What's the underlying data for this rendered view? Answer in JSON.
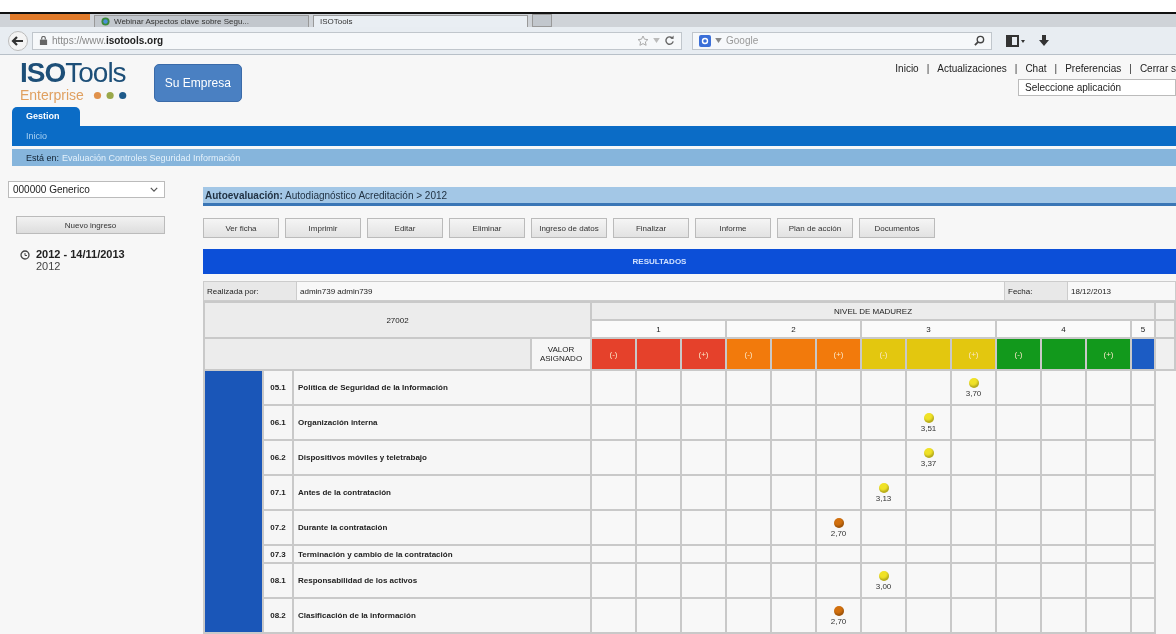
{
  "browser": {
    "tabs": [
      {
        "title": "Webinar Aspectos clave sobre Segu...",
        "selected": false
      },
      {
        "title": "ISOTools",
        "selected": true
      }
    ],
    "url_prefix": "https://www.",
    "url_domain": "isotools.org",
    "search": {
      "placeholder": "Google"
    }
  },
  "header": {
    "logo": {
      "bold": "ISO",
      "rest": "Tools",
      "edition": "Enterprise"
    },
    "company_button": "Su Empresa",
    "links": [
      {
        "label": "Inicio"
      },
      {
        "label": "Actualizaciones"
      },
      {
        "label": "Chat"
      },
      {
        "label": "Preferencias"
      },
      {
        "label": "Cerrar s"
      }
    ],
    "separators": [
      "|",
      "|",
      "|",
      "|"
    ],
    "app_select": {
      "value": "Seleccione aplicación"
    }
  },
  "nav": {
    "tabs": [
      {
        "label": "Gestion",
        "selected": true
      }
    ],
    "subnav": [
      {
        "label": "Inicio"
      }
    ]
  },
  "breadcrumb": {
    "label": "Está en:",
    "path": "Evaluación Controles Seguridad Información"
  },
  "sidebar": {
    "org_select": {
      "value": "000000 Generico"
    },
    "new_button": "Nuevo ingreso",
    "periods": [
      {
        "title": "2012 - 14/11/2013",
        "subtitle": "2012"
      }
    ]
  },
  "evaluation": {
    "label": "Autoevaluación:",
    "title": "Autodiagnóstico Acreditación > 2012"
  },
  "toolbar": [
    "Ver ficha",
    "Imprimir",
    "Editar",
    "Eliminar",
    "Ingreso de datos",
    "Finalizar",
    "Informe",
    "Plan de acción",
    "Documentos"
  ],
  "results": {
    "title": "RESULTADOS",
    "performed_by_label": "Realizada por:",
    "performed_by": "admin739 admin739",
    "date_label": "Fecha:",
    "date": "18/12/2013",
    "standard": "27002",
    "maturity_title": "NIVEL DE MADUREZ",
    "value_header": "VALOR ASIGNADO",
    "levels": [
      {
        "label": "1",
        "color": "#e5412b",
        "bands": [
          {
            "kind": "minus",
            "text": "(-)"
          },
          {
            "kind": "mid"
          },
          {
            "kind": "plus",
            "text": "(+)"
          }
        ]
      },
      {
        "label": "2",
        "color": "#f27a0c",
        "bands": [
          {
            "kind": "minus",
            "text": "(-)"
          },
          {
            "kind": "mid"
          },
          {
            "kind": "plus",
            "text": "(+)"
          }
        ]
      },
      {
        "label": "3",
        "color": "#e3c70f",
        "bands": [
          {
            "kind": "minus",
            "text": "(-)"
          },
          {
            "kind": "mid"
          },
          {
            "kind": "plus",
            "text": "(+)"
          }
        ]
      },
      {
        "label": "4",
        "color": "#12991c",
        "bands": [
          {
            "kind": "minus",
            "text": "(-)"
          },
          {
            "kind": "mid"
          },
          {
            "kind": "plus",
            "text": "(+)"
          }
        ]
      },
      {
        "label": "5",
        "color": "#1c5cc4",
        "bands": [
          {
            "kind": "mid"
          }
        ]
      }
    ],
    "rows": [
      {
        "code": "05.1",
        "name": "Política de Seguridad de la Información",
        "cells": [
          {
            "marked": false
          },
          {
            "marked": false
          },
          {
            "marked": false
          },
          {
            "marked": false
          },
          {
            "marked": false
          },
          {
            "marked": false
          },
          {
            "marked": false
          },
          {
            "marked": false
          },
          {
            "marked": true,
            "value": "3,70",
            "color": "#f0e226"
          },
          {
            "marked": false
          },
          {
            "marked": false
          },
          {
            "marked": false
          },
          {
            "marked": false
          }
        ]
      },
      {
        "code": "06.1",
        "name": "Organización interna",
        "cells": [
          {
            "marked": false
          },
          {
            "marked": false
          },
          {
            "marked": false
          },
          {
            "marked": false
          },
          {
            "marked": false
          },
          {
            "marked": false
          },
          {
            "marked": false
          },
          {
            "marked": true,
            "value": "3,51",
            "color": "#f0e226"
          },
          {
            "marked": false
          },
          {
            "marked": false
          },
          {
            "marked": false
          },
          {
            "marked": false
          },
          {
            "marked": false
          }
        ]
      },
      {
        "code": "06.2",
        "name": "Dispositivos móviles y teletrabajo",
        "cells": [
          {
            "marked": false
          },
          {
            "marked": false
          },
          {
            "marked": false
          },
          {
            "marked": false
          },
          {
            "marked": false
          },
          {
            "marked": false
          },
          {
            "marked": false
          },
          {
            "marked": true,
            "value": "3,37",
            "color": "#f0e226"
          },
          {
            "marked": false
          },
          {
            "marked": false
          },
          {
            "marked": false
          },
          {
            "marked": false
          },
          {
            "marked": false
          }
        ]
      },
      {
        "code": "07.1",
        "name": "Antes de la contratación",
        "cells": [
          {
            "marked": false
          },
          {
            "marked": false
          },
          {
            "marked": false
          },
          {
            "marked": false
          },
          {
            "marked": false
          },
          {
            "marked": false
          },
          {
            "marked": true,
            "value": "3,13",
            "color": "#f0e226"
          },
          {
            "marked": false
          },
          {
            "marked": false
          },
          {
            "marked": false
          },
          {
            "marked": false
          },
          {
            "marked": false
          },
          {
            "marked": false
          }
        ]
      },
      {
        "code": "07.2",
        "name": "Durante la contratación",
        "cells": [
          {
            "marked": false
          },
          {
            "marked": false
          },
          {
            "marked": false
          },
          {
            "marked": false
          },
          {
            "marked": false
          },
          {
            "marked": true,
            "value": "2,70",
            "color": "#d2700e"
          },
          {
            "marked": false
          },
          {
            "marked": false
          },
          {
            "marked": false
          },
          {
            "marked": false
          },
          {
            "marked": false
          },
          {
            "marked": false
          },
          {
            "marked": false
          }
        ]
      },
      {
        "code": "07.3",
        "name": "Terminación y cambio de la contratación",
        "cells": [
          {
            "marked": false
          },
          {
            "marked": false
          },
          {
            "marked": false
          },
          {
            "marked": false
          },
          {
            "marked": false
          },
          {
            "marked": false
          },
          {
            "marked": false
          },
          {
            "marked": false
          },
          {
            "marked": false
          },
          {
            "marked": false
          },
          {
            "marked": false
          },
          {
            "marked": false
          },
          {
            "marked": false
          }
        ]
      },
      {
        "code": "08.1",
        "name": "Responsabilidad de los activos",
        "cells": [
          {
            "marked": false
          },
          {
            "marked": false
          },
          {
            "marked": false
          },
          {
            "marked": false
          },
          {
            "marked": false
          },
          {
            "marked": false
          },
          {
            "marked": true,
            "value": "3,00",
            "color": "#f0e226"
          },
          {
            "marked": false
          },
          {
            "marked": false
          },
          {
            "marked": false
          },
          {
            "marked": false
          },
          {
            "marked": false
          },
          {
            "marked": false
          }
        ]
      },
      {
        "code": "08.2",
        "name": "Clasificación de la información",
        "cells": [
          {
            "marked": false
          },
          {
            "marked": false
          },
          {
            "marked": false
          },
          {
            "marked": false
          },
          {
            "marked": false
          },
          {
            "marked": true,
            "value": "2,70",
            "color": "#d2700e"
          },
          {
            "marked": false
          },
          {
            "marked": false
          },
          {
            "marked": false
          },
          {
            "marked": false
          },
          {
            "marked": false
          },
          {
            "marked": false
          },
          {
            "marked": false
          }
        ]
      }
    ]
  }
}
